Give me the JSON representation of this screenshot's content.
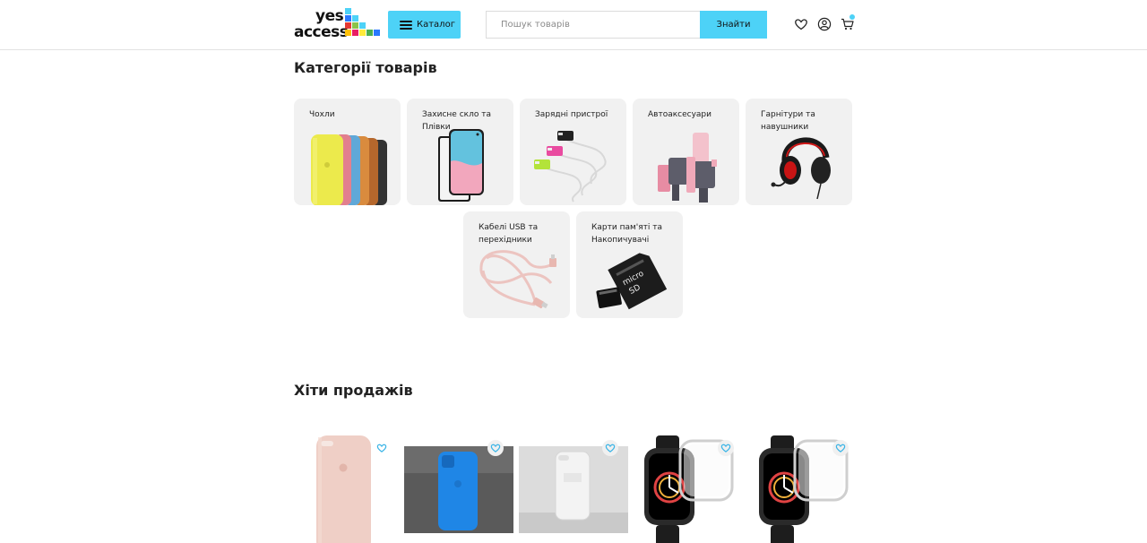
{
  "header": {
    "logo_line1": "yes",
    "logo_line2": "access",
    "catalog_label": "Каталог",
    "search_placeholder": "Пошук товарів",
    "search_button": "Знайти",
    "accent_color": "#4dd2f7"
  },
  "categories": {
    "title": "Категорії товарів",
    "items": [
      {
        "label": "Чохли",
        "icon": "phone-cases-image"
      },
      {
        "label": "Захисне скло та Плівки",
        "icon": "screen-protector-image"
      },
      {
        "label": "Зарядні пристрої",
        "icon": "chargers-image"
      },
      {
        "label": "Автоаксесуари",
        "icon": "car-holder-image"
      },
      {
        "label": "Гарнітури та навушники",
        "icon": "headset-image"
      },
      {
        "label": "Кабелі USB та перехідники",
        "icon": "usb-cable-image"
      },
      {
        "label": "Карти пам'яті та Накопичувачі",
        "icon": "memory-card-image"
      }
    ]
  },
  "bestsellers": {
    "title": "Хіти продажів",
    "items": [
      {
        "image": "pink-iphone-case"
      },
      {
        "image": "blue-iphone-case"
      },
      {
        "image": "white-iphone-case"
      },
      {
        "image": "apple-watch-protector"
      },
      {
        "image": "apple-watch-protector"
      }
    ]
  }
}
